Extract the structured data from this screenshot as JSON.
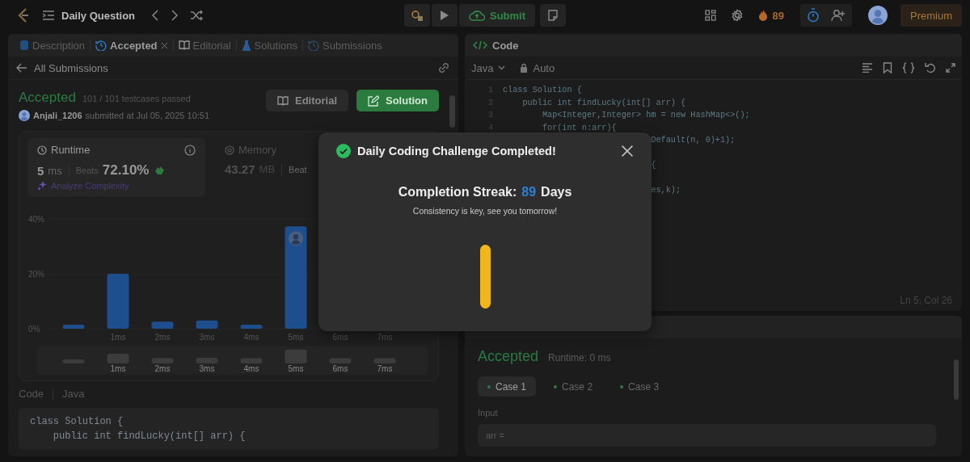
{
  "top_bar": {
    "title": "Daily Question",
    "submit": "Submit",
    "streak_count": "89",
    "premium": "Premium"
  },
  "left_tabs": [
    {
      "label": "Description",
      "kind": "description",
      "selected": false,
      "closable": false
    },
    {
      "label": "Accepted",
      "kind": "history",
      "selected": true,
      "closable": true
    },
    {
      "label": "Editorial",
      "kind": "book",
      "selected": false,
      "closable": false
    },
    {
      "label": "Solutions",
      "kind": "flask",
      "selected": false,
      "closable": false
    },
    {
      "label": "Submissions",
      "kind": "history",
      "selected": false,
      "closable": false
    }
  ],
  "submission": {
    "back": "All Submissions",
    "status": "Accepted",
    "passed": "101 / 101 testcases passed",
    "user": "Anjali_1206",
    "submitted": "submitted at Jul 05, 2025 10:51",
    "buttons": [
      {
        "label": "Editorial",
        "kind": "editorial"
      },
      {
        "label": "Solution",
        "kind": "solution"
      }
    ]
  },
  "runtime": {
    "title": "Runtime",
    "value": "5",
    "unit": "ms",
    "beats_label": "Beats",
    "beats": "72.10%",
    "analyze": "Analyze Complexity"
  },
  "memory": {
    "title": "Memory",
    "value": "43.27",
    "unit": "MB",
    "beats_label": "Beat"
  },
  "distribution": {
    "chart_data": {
      "type": "bar",
      "categories": [
        null,
        "1ms",
        "2ms",
        "3ms",
        "4ms",
        "5ms",
        "6ms",
        "7ms"
      ],
      "values": [
        1.5,
        20,
        2.6,
        3,
        1.5,
        37.3,
        null,
        null
      ],
      "ylim": [
        0,
        40
      ],
      "yticks": [
        {
          "value": 0,
          "label": "0%"
        },
        {
          "value": 20,
          "label": "20%"
        },
        {
          "value": 40,
          "label": "40%"
        }
      ]
    },
    "brush_labels": [
      "1ms",
      "2ms",
      "3ms",
      "4ms",
      "5ms",
      "6ms",
      "7ms"
    ]
  },
  "code_section": {
    "label": "Code",
    "language": "Java",
    "lines": [
      "class Solution {",
      "    public int findLucky(int[] arr) {"
    ]
  },
  "editor": {
    "title": "Code",
    "language": "Java",
    "mode": "Auto",
    "cursor": "Ln 5, Col 26",
    "lines": [
      {
        "kind": "full",
        "number": "1",
        "text": "class Solution {"
      },
      {
        "kind": "full",
        "number": "2",
        "text": "    public int findLucky(int[] arr) {"
      },
      {
        "kind": "full",
        "number": "3",
        "text": "        Map<Integer,Integer> hm = new HashMap<>();"
      },
      {
        "kind": "full",
        "number": "4",
        "text": "        for(int n:arr){"
      },
      {
        "kind": "partial",
        "text": "Default(n, 0)+1);"
      },
      {
        "kind": "blank"
      },
      {
        "kind": "partial",
        "text": "{"
      },
      {
        "kind": "blank"
      },
      {
        "kind": "partial",
        "text": "es,k);"
      }
    ]
  },
  "result": {
    "status": "Accepted",
    "runtime": "Runtime: 0 ms",
    "input_label": "Input",
    "input_value": "arr =",
    "cases": [
      {
        "label": "Case 1",
        "selected": true
      },
      {
        "label": "Case 2",
        "selected": false
      },
      {
        "label": "Case 3",
        "selected": false
      }
    ]
  },
  "modal": {
    "title": "Daily Coding Challenge Completed!",
    "streak_label": "Completion Streak:",
    "streak_value": "89",
    "streak_unit": "Days",
    "message": "Consistency is key, see you tomorrow!"
  }
}
